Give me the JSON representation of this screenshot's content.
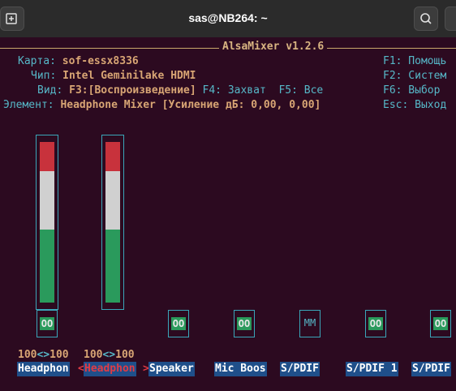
{
  "window": {
    "title": "sas@NB264: ~",
    "new_tab_icon": "new-tab-icon",
    "search_icon": "search-icon",
    "menu_icon": "hamburger-menu-icon"
  },
  "mixer": {
    "title": "AlsaMixer v1.2.6",
    "card_label": "Карта:",
    "card_value": "sof-essx8336",
    "chip_label": "Чип:",
    "chip_value": "Intel Geminilake HDMI",
    "view_label": "Вид:",
    "view_value": "F3:[Воспроизведение]",
    "view_capture": "F4: Захват",
    "view_all": "F5: Все",
    "element_label": "Элемент:",
    "element_value": "Headphone Mixer [Усиление дБ: 0,00, 0,00]",
    "keys": [
      "F1: Помощь",
      "F2: Систем",
      "F6: Выбор",
      "Esc: Выход"
    ]
  },
  "channels": [
    {
      "name": "Headphon",
      "mute": "OO",
      "volume": "100<>100",
      "level": 1.0
    },
    {
      "name": "Headphon",
      "mute": "",
      "volume": "100<>100",
      "level": 1.0,
      "active": true
    },
    {
      "name": "Speaker",
      "mute": "OO"
    },
    {
      "name": "Mic Boos",
      "mute": "OO"
    },
    {
      "name": "S/PDIF",
      "mute": "MM"
    },
    {
      "name": "S/PDIF 1",
      "mute": "OO"
    },
    {
      "name": "S/PDIF",
      "mute": "OO"
    }
  ],
  "colors": {
    "background": "#2c0a20",
    "level_red": "#c8323c",
    "level_white": "#d0d0d0",
    "level_green": "#2a9a5c",
    "selected": "#1f4f8a"
  }
}
